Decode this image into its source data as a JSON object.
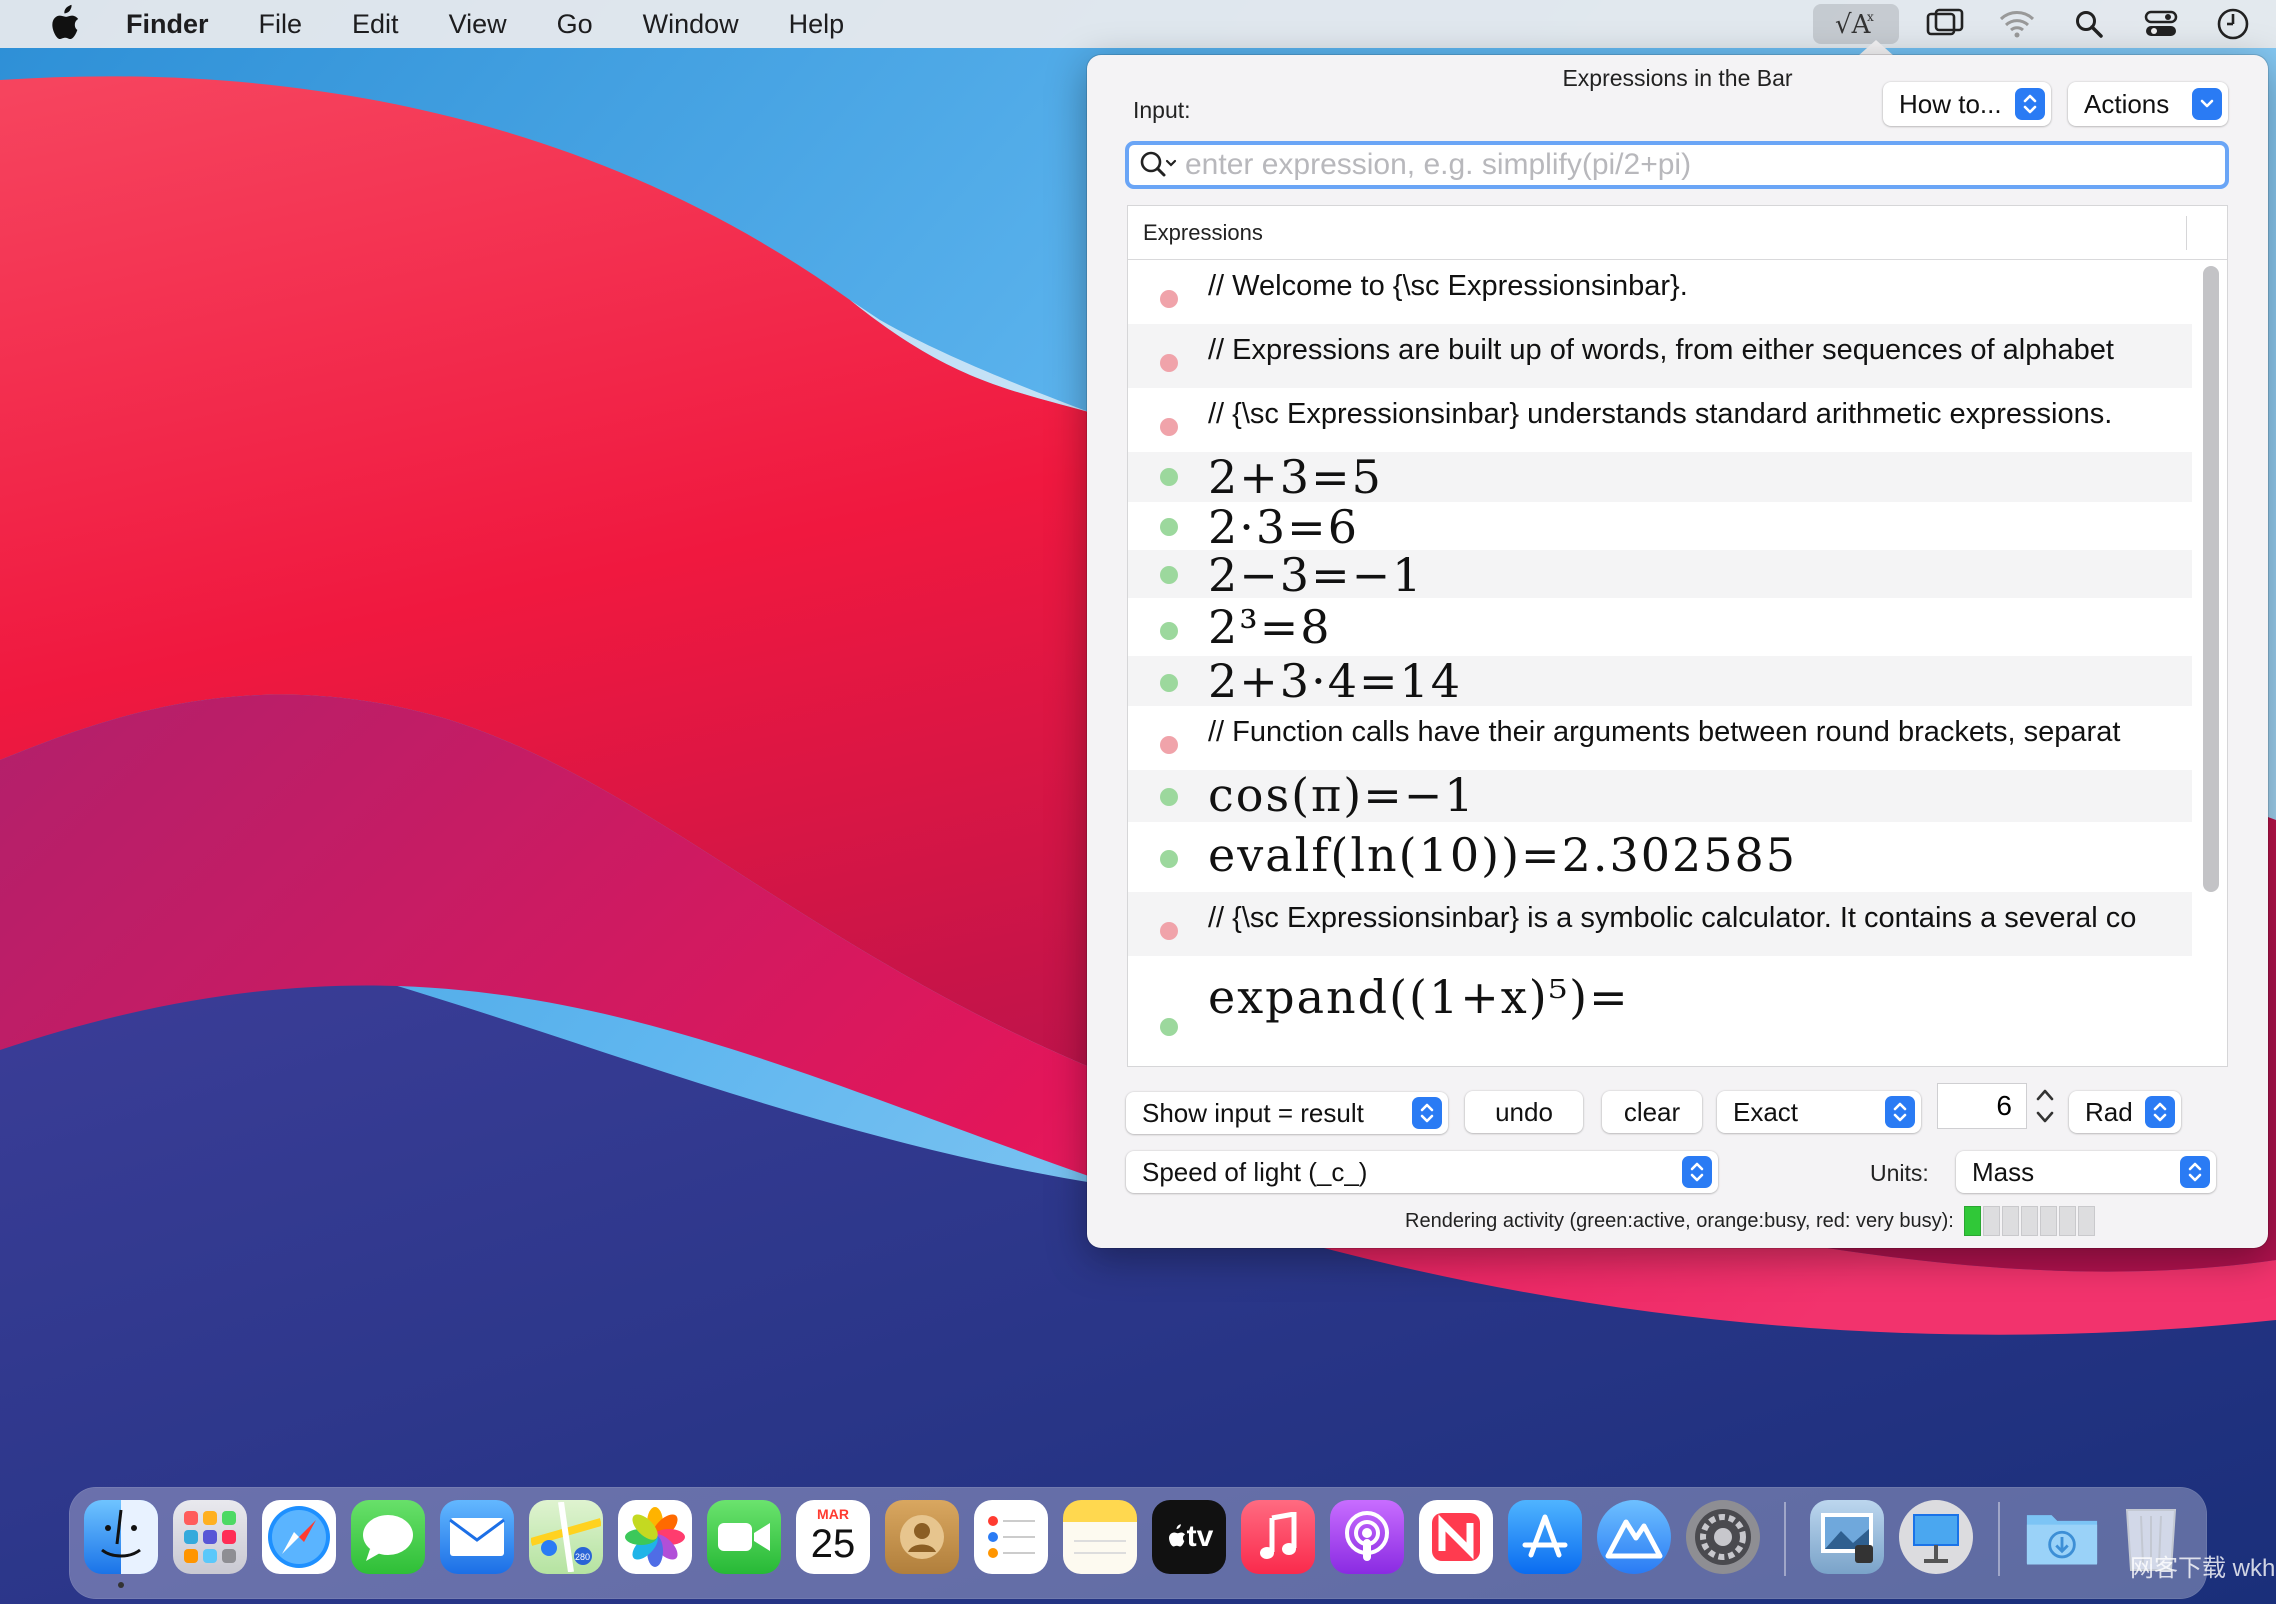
{
  "menubar": {
    "app_name": "Finder",
    "items": [
      "File",
      "Edit",
      "View",
      "Go",
      "Window",
      "Help"
    ],
    "status_icons": [
      "expressions-in-bar-icon",
      "screen-mirroring-icon",
      "wifi-icon",
      "spotlight-icon",
      "control-center-icon",
      "clock-icon"
    ]
  },
  "window": {
    "title": "Expressions in the Bar",
    "input_label": "Input:",
    "howto_label": "How to...",
    "actions_label": "Actions",
    "search_placeholder": "enter expression, e.g. simplify(pi/2+pi)",
    "search_value": ""
  },
  "table": {
    "header": "Expressions",
    "rows": [
      {
        "status": "red",
        "kind": "comment",
        "content": "// Welcome to  {\\sc Expressionsinbar}."
      },
      {
        "status": "red",
        "kind": "comment",
        "content": "// Expressions are  built up of words, from either sequences of alphabet"
      },
      {
        "status": "red",
        "kind": "comment",
        "content": "// {\\sc Expressionsinbar} understands standard  arithmetic expressions."
      },
      {
        "status": "green",
        "kind": "math",
        "content": "2+3=5"
      },
      {
        "status": "green",
        "kind": "math",
        "content": "2·3=6"
      },
      {
        "status": "green",
        "kind": "math",
        "content": "2−3=−1"
      },
      {
        "status": "green",
        "kind": "math",
        "content": "2³=8"
      },
      {
        "status": "green",
        "kind": "math",
        "content": "2+3·4=14"
      },
      {
        "status": "red",
        "kind": "comment",
        "content": "// Function calls have their arguments between round brackets, separat"
      },
      {
        "status": "green",
        "kind": "math",
        "content": "cos(π)=−1"
      },
      {
        "status": "green",
        "kind": "math",
        "content": "evalf(ln(10))=2.302585"
      },
      {
        "status": "red",
        "kind": "comment",
        "content": "// {\\sc Expressionsinbar} is a symbolic calculator. It contains a several co"
      },
      {
        "status": "green",
        "kind": "math",
        "content": "expand((1+x)⁵)="
      }
    ]
  },
  "controls": {
    "display_mode": "Show input = result",
    "undo_label": "undo",
    "clear_label": "clear",
    "precision_mode": "Exact",
    "digits": "6",
    "angle_mode": "Rad",
    "constant": "Speed of light (_c_)",
    "units_label": "Units:",
    "units_value": "Mass",
    "activity_label": "Rendering activity (green:active, orange:busy, red: very busy):",
    "activity_level": 1,
    "activity_cells": 7
  },
  "calendar": {
    "month": "MAR",
    "day": "25"
  },
  "appletv_label": "tv",
  "watermark": "网客下载 wkhub.com",
  "colors": {
    "accent": "#2a7bf4",
    "status_red": "#f0a3aa",
    "status_green": "#9cd89d",
    "activity_on": "#30c838"
  }
}
